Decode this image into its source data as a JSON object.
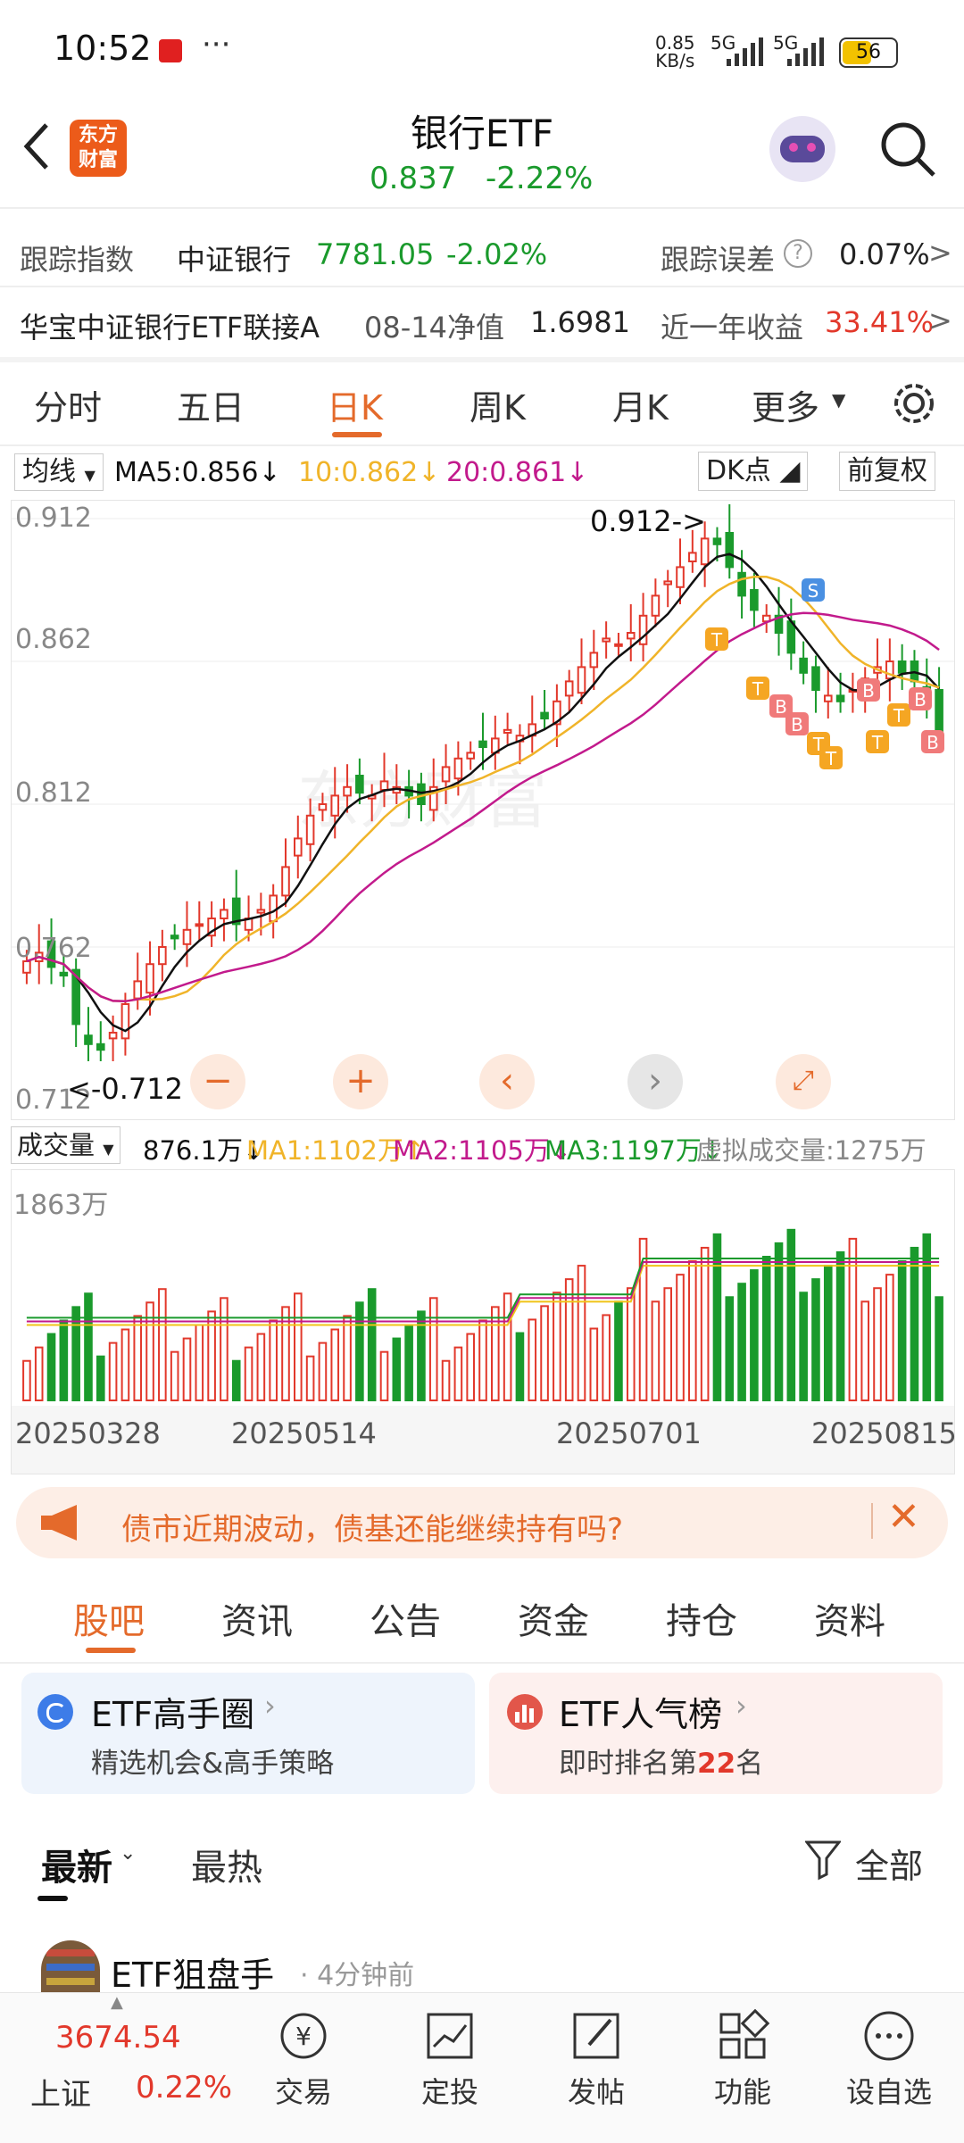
{
  "status_bar": {
    "time": "10:52",
    "net_speed": "0.85\nKB/s",
    "signal1": "5G",
    "signal2": "5G",
    "battery": "56"
  },
  "header": {
    "title": "银行ETF",
    "price": "0.837",
    "change": "-2.22%",
    "logo_text": "东方\n财富"
  },
  "tracking": {
    "label": "跟踪指数",
    "index_name": "中证银行",
    "index_value": "7781.05",
    "index_change": "-2.02%",
    "error_label": "跟踪误差",
    "error_value": "0.07%"
  },
  "linked": {
    "name": "华宝中证银行ETF联接A",
    "nav_label": "08-14净值",
    "nav_value": "1.6981",
    "yield_label": "近一年收益",
    "yield_value": "33.41%"
  },
  "chart_tabs": [
    "分时",
    "五日",
    "日K",
    "周K",
    "月K",
    "更多"
  ],
  "active_tab": "日K",
  "ma_bar": {
    "selector": "均线",
    "ma5": "MA5:0.856",
    "ma10": "10:0.862",
    "ma20": "20:0.861",
    "dk": "DK点",
    "adjust": "前复权"
  },
  "vol_bar": {
    "selector": "成交量",
    "vol": "876.1万",
    "ma1": "MA1:1102万",
    "ma2": "MA2:1105万",
    "ma3": "MA3:1197万",
    "virtual": "虚拟成交量:1275万"
  },
  "vol_max_label": "1863万",
  "chart_data": {
    "type": "candlestick",
    "y_ticks": [
      "0.912",
      "0.862",
      "0.812",
      "0.762",
      "0.712"
    ],
    "ylim": [
      0.712,
      0.912
    ],
    "max_label": "0.912->",
    "min_label": "<-0.712",
    "x_labels": [
      "20250328",
      "20250514",
      "20250701",
      "20250815"
    ],
    "series": [
      {
        "name": "MA5",
        "color": "#111111"
      },
      {
        "name": "MA10",
        "color": "#f0b429"
      },
      {
        "name": "MA20",
        "color": "#c21a8c"
      }
    ],
    "volume_series": [
      {
        "name": "MA1",
        "color": "#f0c419"
      },
      {
        "name": "MA2",
        "color": "#c21a8c"
      },
      {
        "name": "MA3",
        "color": "#1a9a2c"
      }
    ],
    "close_values": [
      0.757,
      0.76,
      0.755,
      0.752,
      0.735,
      0.728,
      0.726,
      0.732,
      0.742,
      0.75,
      0.756,
      0.762,
      0.765,
      0.768,
      0.77,
      0.772,
      0.775,
      0.77,
      0.772,
      0.775,
      0.78,
      0.79,
      0.8,
      0.808,
      0.812,
      0.815,
      0.818,
      0.816,
      0.815,
      0.82,
      0.818,
      0.815,
      0.812,
      0.818,
      0.825,
      0.828,
      0.83,
      0.832,
      0.835,
      0.838,
      0.836,
      0.84,
      0.842,
      0.848,
      0.855,
      0.86,
      0.865,
      0.87,
      0.868,
      0.872,
      0.878,
      0.885,
      0.89,
      0.895,
      0.9,
      0.905,
      0.903,
      0.895,
      0.885,
      0.88,
      0.878,
      0.872,
      0.865,
      0.858,
      0.852,
      0.85,
      0.848,
      0.852,
      0.856,
      0.86,
      0.862,
      0.858,
      0.855,
      0.85,
      0.837
    ],
    "markers": [
      "T",
      "T",
      "B",
      "B",
      "T",
      "T",
      "B",
      "T",
      "T",
      "B",
      "B",
      "S",
      "S"
    ]
  },
  "banner": {
    "text": "债市近期波动，债基还能继续持有吗?"
  },
  "sub_tabs": [
    "股吧",
    "资讯",
    "公告",
    "资金",
    "持仓",
    "资料"
  ],
  "cards": [
    {
      "title": "ETF高手圈",
      "subtitle": "精选机会&高手策略"
    },
    {
      "title": "ETF人气榜",
      "subtitle_prefix": "即时排名第",
      "rank": "22",
      "subtitle_suffix": "名"
    }
  ],
  "feed": {
    "tabs": [
      "最新",
      "最热"
    ],
    "filter": "全部",
    "first_user": "ETF狙盘手",
    "first_time": "4分钟前"
  },
  "bottom_nav": {
    "index_value": "3674.54",
    "index_name": "上证",
    "index_change": "0.22%",
    "items": [
      "交易",
      "定投",
      "发帖",
      "功能",
      "设自选"
    ]
  }
}
